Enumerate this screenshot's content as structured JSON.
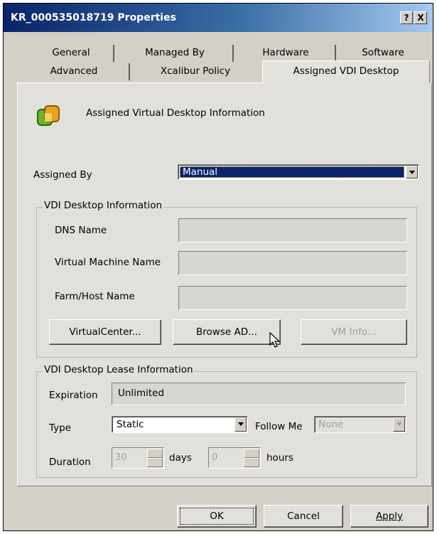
{
  "window": {
    "title": "KR_000535018719 Properties",
    "help_label": "?",
    "close_label": "X"
  },
  "tabs": {
    "row1": [
      "General",
      "Managed By",
      "Hardware",
      "Software"
    ],
    "row2": [
      "Advanced",
      "Xcalibur Policy",
      "Assigned VDI Desktop"
    ],
    "active": "Assigned VDI Desktop"
  },
  "header": {
    "icon": "vmware-logo-icon",
    "title": "Assigned Virtual Desktop Information"
  },
  "assigned_by": {
    "label": "Assigned By",
    "value": "Manual"
  },
  "vdi_info": {
    "title": "VDI Desktop Information",
    "dns_label": "DNS Name",
    "dns_value": "",
    "vm_label": "Virtual Machine Name",
    "vm_value": "",
    "farm_label": "Farm/Host Name",
    "farm_value": "",
    "virtualcenter_button": "VirtualCenter...",
    "browse_button": "Browse AD...",
    "vminfo_button": "VM Info..."
  },
  "lease": {
    "title": "VDI Desktop Lease Information",
    "expiration_label": "Expiration",
    "expiration_value": "Unlimited",
    "type_label": "Type",
    "type_value": "Static",
    "followme_label": "Follow Me",
    "followme_value": "None",
    "duration_label": "Duration",
    "duration_days": "30",
    "days_label": "days",
    "duration_hours": "0",
    "hours_label": "hours"
  },
  "footer": {
    "ok": "OK",
    "cancel": "Cancel",
    "apply": "Apply"
  },
  "colors": {
    "title_start": "#0a246a",
    "title_end": "#a6caf0",
    "selection": "#0a246a"
  }
}
